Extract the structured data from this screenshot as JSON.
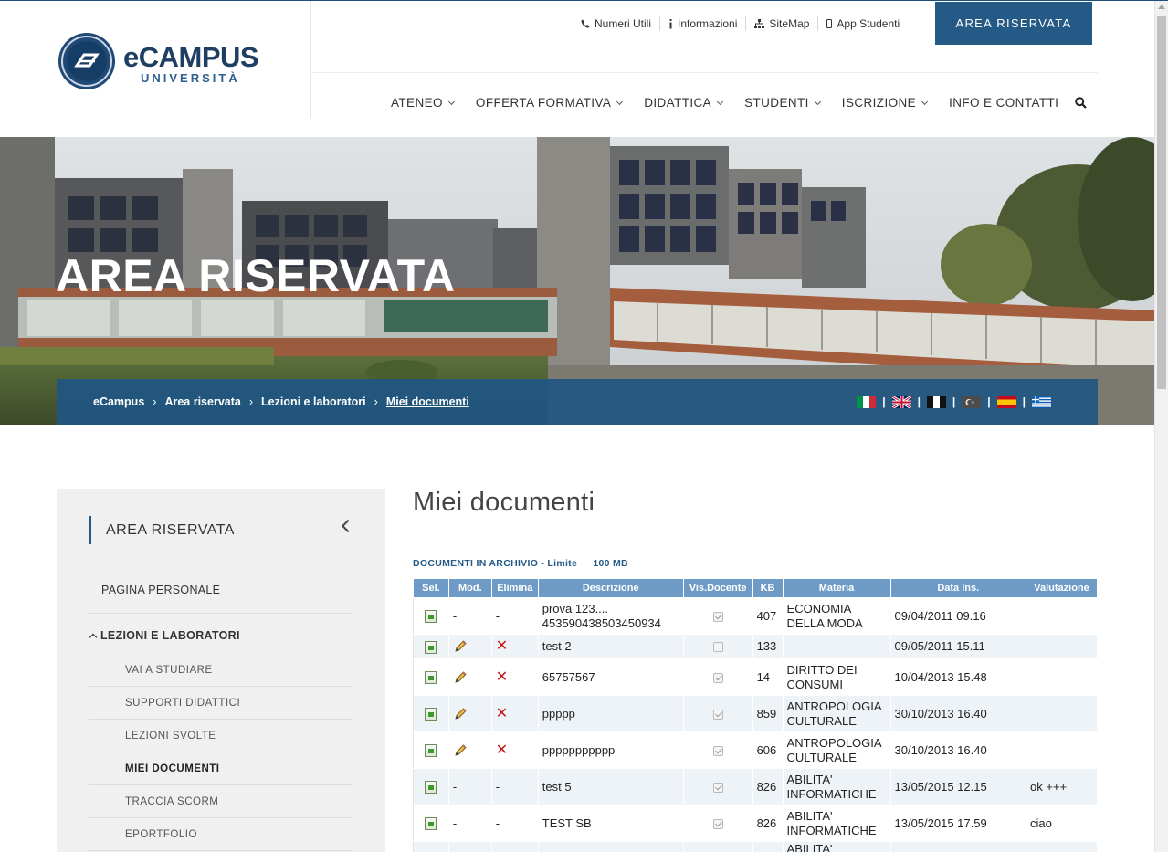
{
  "brand": {
    "logo_main": "eCAMPUS",
    "logo_sub": "UNIVERSITÀ",
    "accent_color": "#255a86"
  },
  "toplinks": [
    {
      "label": "Numeri Utili",
      "icon": "phone-icon"
    },
    {
      "label": "Informazioni",
      "icon": "info-icon"
    },
    {
      "label": "SiteMap",
      "icon": "sitemap-icon"
    },
    {
      "label": "App Studenti",
      "icon": "mobile-icon"
    }
  ],
  "area_button": "AREA RISERVATA",
  "nav": [
    "ATENEO",
    "OFFERTA FORMATIVA",
    "DIDATTICA",
    "STUDENTI",
    "ISCRIZIONE",
    "INFO E CONTATTI"
  ],
  "hero": {
    "title": "AREA RISERVATA"
  },
  "breadcrumb": [
    "eCampus",
    "Area riservata",
    "Lezioni e laboratori",
    "Miei documenti"
  ],
  "flags": [
    "flag-it-icon",
    "flag-gb-icon",
    "flag-fr-icon",
    "flag-tr-icon",
    "flag-es-icon",
    "flag-gr-icon"
  ],
  "sidebar": {
    "title": "AREA RISERVATA",
    "items": [
      {
        "label": "PAGINA PERSONALE"
      },
      {
        "label": "LEZIONI E LABORATORI"
      }
    ],
    "subitems": [
      {
        "label": "VAI A STUDIARE"
      },
      {
        "label": "SUPPORTI DIDATTICI"
      },
      {
        "label": "LEZIONI SVOLTE"
      },
      {
        "label": "MIEI DOCUMENTI"
      },
      {
        "label": "TRACCIA SCORM"
      },
      {
        "label": "EPORTFOLIO"
      }
    ]
  },
  "main": {
    "title": "Miei documenti",
    "archive_label": "DOCUMENTI IN ARCHIVIO - Limite",
    "archive_limit": "100 MB",
    "columns": [
      "Sel.",
      "Mod.",
      "Elimina",
      "Descrizione",
      "Vis.Docente",
      "KB",
      "Materia",
      "Data Ins.",
      "Valutazione"
    ],
    "rows": [
      {
        "mod": "-",
        "del": "-",
        "desc": "prova 123.... 453590438503450934",
        "vis": true,
        "kb": "407",
        "materia": "ECONOMIA DELLA MODA",
        "data": "09/04/2011 09.16",
        "val": ""
      },
      {
        "mod": "pencil",
        "del": "x",
        "desc": "test 2",
        "vis": false,
        "kb": "133",
        "materia": "",
        "data": "09/05/2011 15.11",
        "val": ""
      },
      {
        "mod": "pencil",
        "del": "x",
        "desc": "65757567",
        "vis": true,
        "kb": "14",
        "materia": "DIRITTO DEI CONSUMI",
        "data": "10/04/2013 15.48",
        "val": ""
      },
      {
        "mod": "pencil",
        "del": "x",
        "desc": "ppppp",
        "vis": true,
        "kb": "859",
        "materia": "ANTROPOLOGIA CULTURALE",
        "data": "30/10/2013 16.40",
        "val": ""
      },
      {
        "mod": "pencil",
        "del": "x",
        "desc": "ppppppppppp",
        "vis": true,
        "kb": "606",
        "materia": "ANTROPOLOGIA CULTURALE",
        "data": "30/10/2013 16.40",
        "val": ""
      },
      {
        "mod": "-",
        "del": "-",
        "desc": "test 5",
        "vis": true,
        "kb": "826",
        "materia": "ABILITA' INFORMATICHE",
        "data": "13/05/2015 12.15",
        "val": "ok +++"
      },
      {
        "mod": "-",
        "del": "-",
        "desc": "TEST SB",
        "vis": true,
        "kb": "826",
        "materia": "ABILITA' INFORMATICHE",
        "data": "13/05/2015 17.59",
        "val": "ciao"
      },
      {
        "mod": "",
        "del": "",
        "desc": "",
        "vis": null,
        "kb": "",
        "materia": "ABILITA'",
        "data": "",
        "val": ""
      }
    ]
  }
}
